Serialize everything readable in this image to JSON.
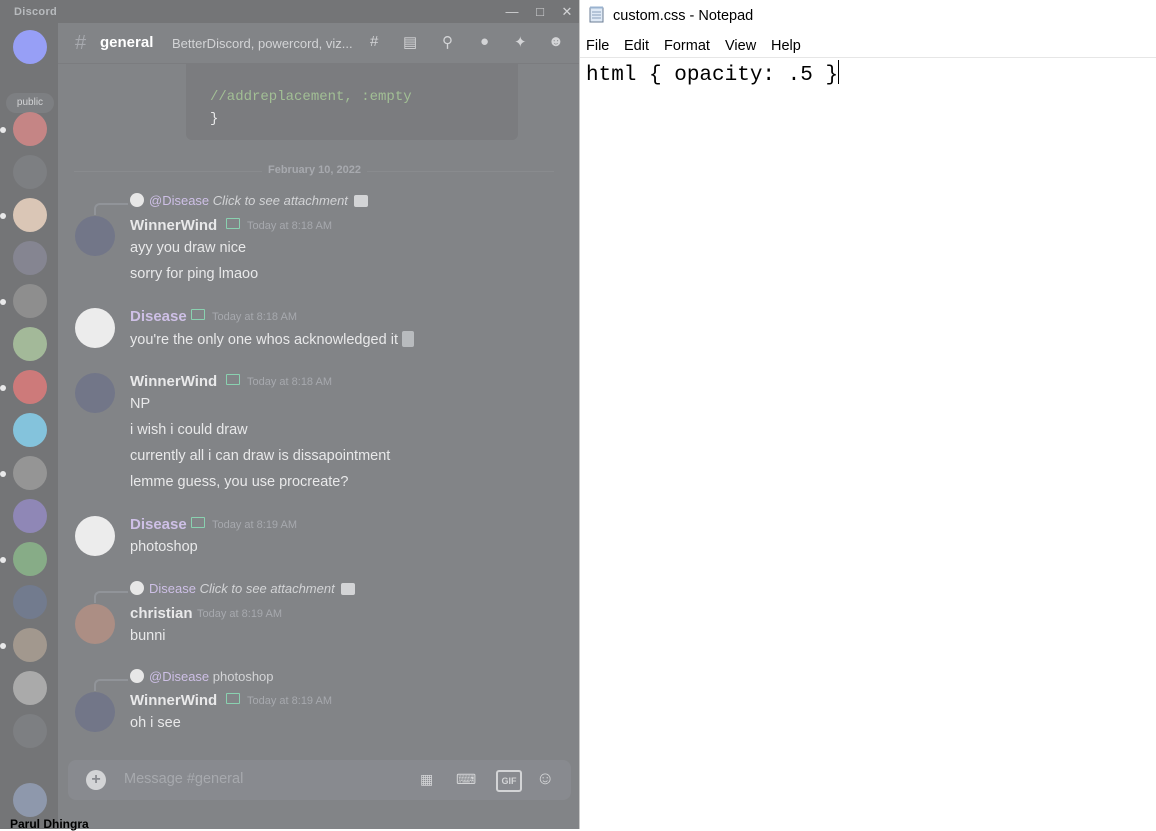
{
  "discord": {
    "brand": "Discord",
    "server_label": "public",
    "channel": {
      "name": "general",
      "topic": "BetterDiscord, powercord, viz..."
    },
    "code": {
      "line1": "//addreplacement, :empty",
      "line2": "}"
    },
    "date_divider": "February 10, 2022",
    "messages": [
      {
        "reply": {
          "mention": "@Disease",
          "text": "Click to see attachment"
        },
        "author": "WinnerWind",
        "time": "Today at 8:18 AM",
        "author_color": "#dcddde",
        "lines": [
          "ayy you draw nice",
          "sorry for ping lmaoo"
        ]
      },
      {
        "author": "Disease",
        "time": "Today at 8:18 AM",
        "author_color": "#b19ad8",
        "lines": [
          "you're the only one whos acknowledged it"
        ]
      },
      {
        "author": "WinnerWind",
        "time": "Today at 8:18 AM",
        "author_color": "#dcddde",
        "lines": [
          "NP",
          "i wish i could draw",
          "currently all i can draw is dissapointment",
          "lemme guess, you use procreate?"
        ]
      },
      {
        "author": "Disease",
        "time": "Today at 8:19 AM",
        "author_color": "#b19ad8",
        "lines": [
          "photoshop"
        ]
      },
      {
        "reply": {
          "mention": "Disease",
          "text": "Click to see attachment"
        },
        "author": "christian",
        "time": "Today at 8:19 AM",
        "author_color": "#dcddde",
        "lines": [
          "bunni"
        ]
      },
      {
        "reply": {
          "mention": "@Disease",
          "text": "photoshop"
        },
        "author": "WinnerWind",
        "time": "Today at 8:19 AM",
        "author_color": "#dcddde",
        "lines": [
          "oh i see"
        ]
      }
    ],
    "composer": {
      "placeholder": "Message #general",
      "gif_label": "GIF"
    },
    "bottom_cut_text": "Parul Dhingra"
  },
  "notepad": {
    "title": "custom.css - Notepad",
    "menu": [
      "File",
      "Edit",
      "Format",
      "View",
      "Help"
    ],
    "content": "html { opacity: .5 }"
  }
}
